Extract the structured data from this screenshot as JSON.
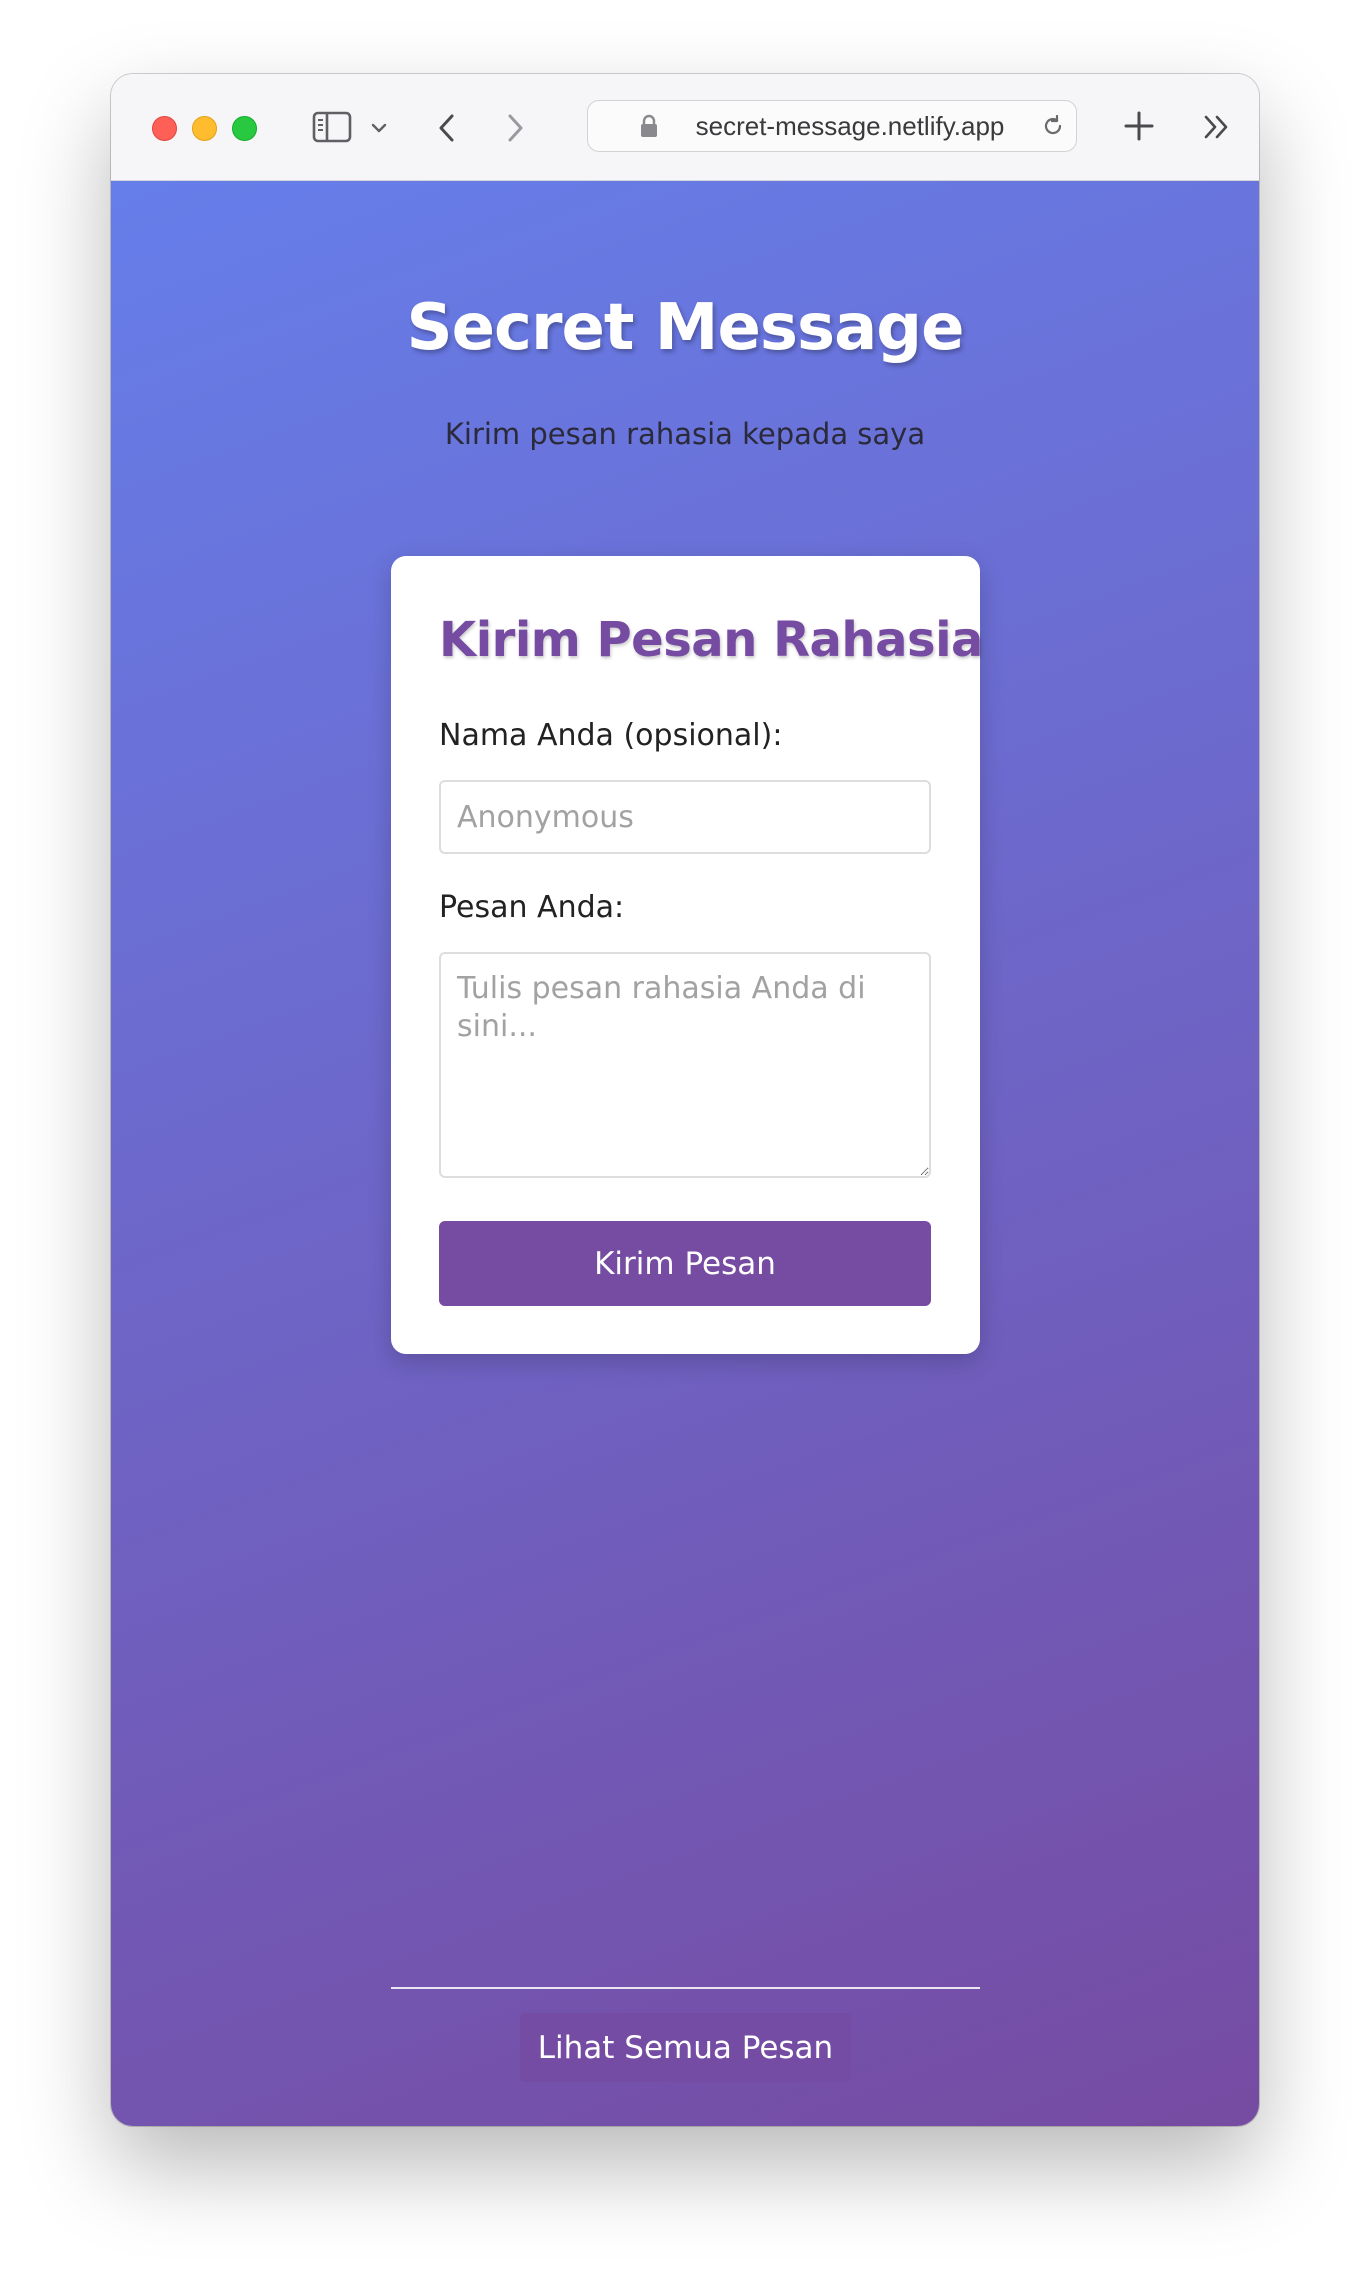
{
  "browser": {
    "url": "secret-message.netlify.app",
    "icons": {
      "sidebar": "sidebar-icon",
      "dropdown": "chevron-down-icon",
      "back": "chevron-left-icon",
      "forward": "chevron-right-icon",
      "lock": "lock-icon",
      "reload": "reload-icon",
      "new_tab": "plus-icon",
      "more": "double-chevron-right-icon"
    }
  },
  "hero": {
    "title": "Secret Message",
    "subtitle": "Kirim pesan rahasia kepada saya"
  },
  "form": {
    "title": "Kirim Pesan Rahasia",
    "name_label": "Nama Anda (opsional):",
    "name_value": "",
    "name_placeholder": "Anonymous",
    "message_label": "Pesan Anda:",
    "message_value": "",
    "message_placeholder": "Tulis pesan rahasia Anda di sini...",
    "submit_label": "Kirim Pesan"
  },
  "footer": {
    "view_all_label": "Lihat Semua Pesan"
  },
  "colors": {
    "gradient_start": "#667eea",
    "gradient_end": "#764ba2",
    "accent": "#764ba2"
  }
}
